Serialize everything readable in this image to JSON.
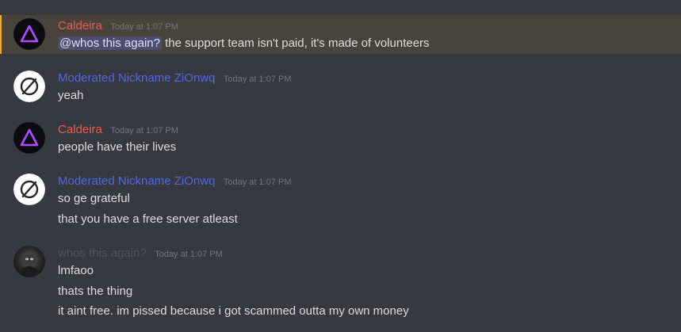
{
  "colors": {
    "background": "#36393f",
    "caldeira": "#ed5a52",
    "moderated": "#4f6ae6",
    "whos": "#4f545c",
    "mention_highlight": "#faa81a"
  },
  "messages": [
    {
      "author": "Caldeira",
      "timestamp": "Today at 1:07 PM",
      "avatar_icon": "purple-triangle-icon",
      "mentioned": true,
      "mention": "@whos this again?",
      "lines": [
        "the support team isn't paid, it's made of volunteers"
      ]
    },
    {
      "author": "Moderated Nickname ZiOnwq",
      "timestamp": "Today at 1:07 PM",
      "avatar_icon": "null-circle-icon",
      "lines": [
        "yeah"
      ]
    },
    {
      "author": "Caldeira",
      "timestamp": "Today at 1:07 PM",
      "avatar_icon": "purple-triangle-icon",
      "lines": [
        "people have their lives"
      ]
    },
    {
      "author": "Moderated Nickname ZiOnwq",
      "timestamp": "Today at 1:07 PM",
      "avatar_icon": "null-circle-icon",
      "lines": [
        "so ge grateful",
        "that you have a free server atleast"
      ]
    },
    {
      "author": "whos this again?",
      "timestamp": "Today at 1:07 PM",
      "avatar_icon": "dark-photo-avatar-icon",
      "lines": [
        "lmfaoo",
        "thats the thing",
        "it aint free. im pissed because i got scammed outta my own money"
      ]
    }
  ]
}
